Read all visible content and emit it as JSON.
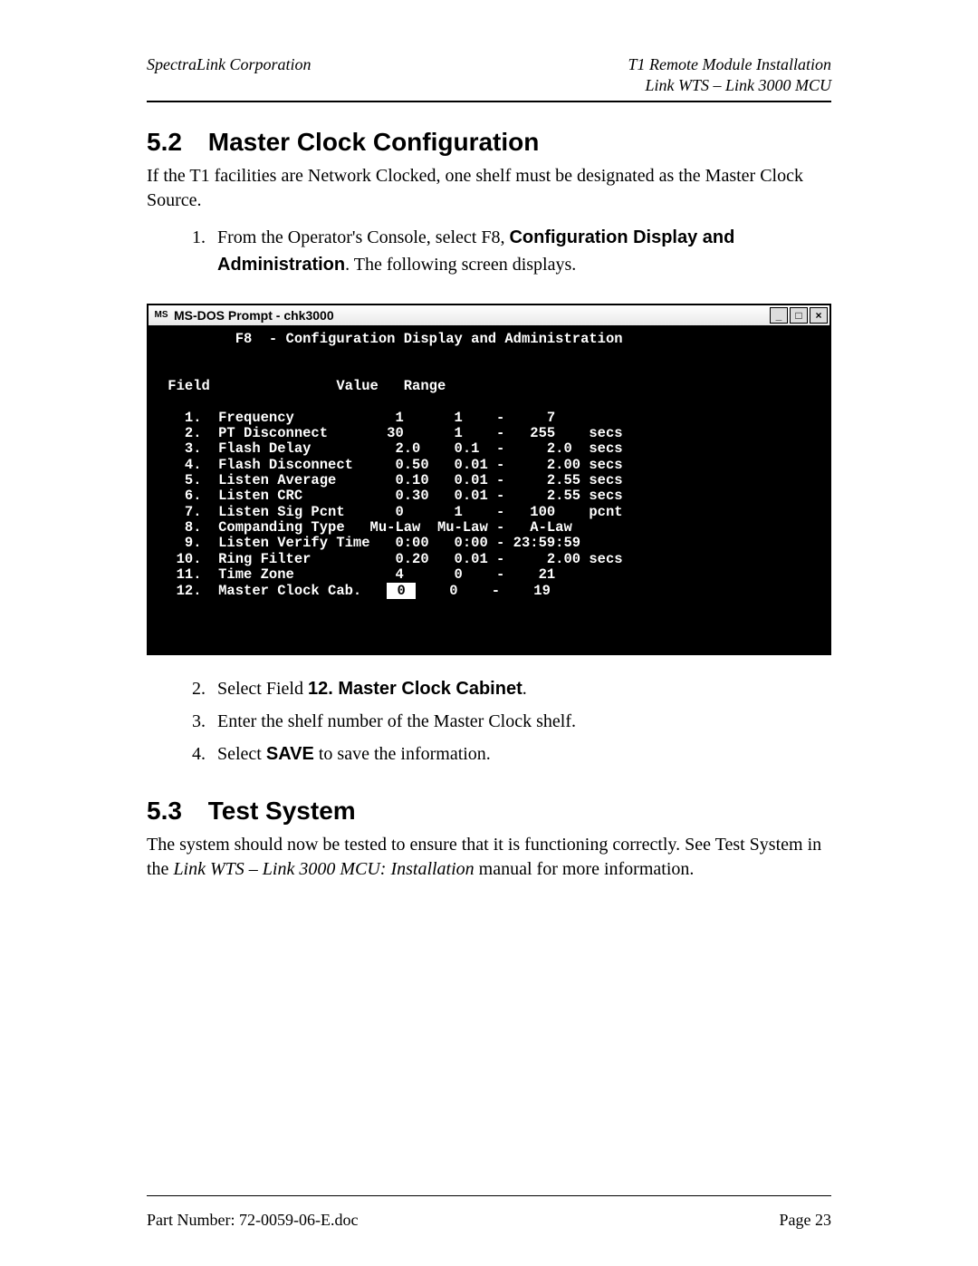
{
  "header": {
    "left": "SpectraLink Corporation",
    "right_line1": "T1 Remote Module Installation",
    "right_line2": "Link WTS – Link 3000 MCU"
  },
  "section52": {
    "num": "5.2",
    "title": "Master Clock Configuration",
    "para": "If the T1 facilities are Network Clocked, one shelf must be designated as the Master Clock Source.",
    "step1_a": "From the Operator's Console, select F8, ",
    "step1_b": "Configuration Display and Administration",
    "step1_c": ".  The following screen displays.",
    "step2_a": "Select Field ",
    "step2_b": "12. Master Clock Cabinet",
    "step2_c": ".",
    "step3": "Enter the shelf number of the Master Clock shelf.",
    "step4_a": "Select ",
    "step4_b": "SAVE",
    "step4_c": " to save the information."
  },
  "console": {
    "app_icon": "MS",
    "title": "MS-DOS Prompt - chk3000",
    "heading": "         F8  - Configuration Display and Administration",
    "col_header": " Field               Value   Range",
    "rows": [
      "   1.  Frequency            1      1    -     7",
      "   2.  PT Disconnect       30      1    -   255    secs",
      "   3.  Flash Delay          2.0    0.1  -     2.0  secs",
      "   4.  Flash Disconnect     0.50   0.01 -     2.00 secs",
      "   5.  Listen Average       0.10   0.01 -     2.55 secs",
      "   6.  Listen CRC           0.30   0.01 -     2.55 secs",
      "   7.  Listen Sig Pcnt      0      1    -   100    pcnt",
      "   8.  Companding Type   Mu-Law  Mu-Law -   A-Law",
      "   9.  Listen Verify Time   0:00   0:00 - 23:59:59",
      "  10.  Ring Filter          0.20   0.01 -     2.00 secs",
      "  11.  Time Zone            4      0    -    21"
    ],
    "row12_prefix": "  12.  Master Clock Cab.   ",
    "row12_value": " 0 ",
    "row12_suffix": "    0    -    19"
  },
  "section53": {
    "num": "5.3",
    "title": "Test System",
    "para_a": "The system should now be tested to ensure that it is functioning correctly.  See Test System in the ",
    "para_b": "Link WTS – Link 3000 MCU: Installation",
    "para_c": " manual for more information."
  },
  "footer": {
    "left": "Part Number: 72-0059-06-E.doc",
    "right": "Page 23"
  }
}
